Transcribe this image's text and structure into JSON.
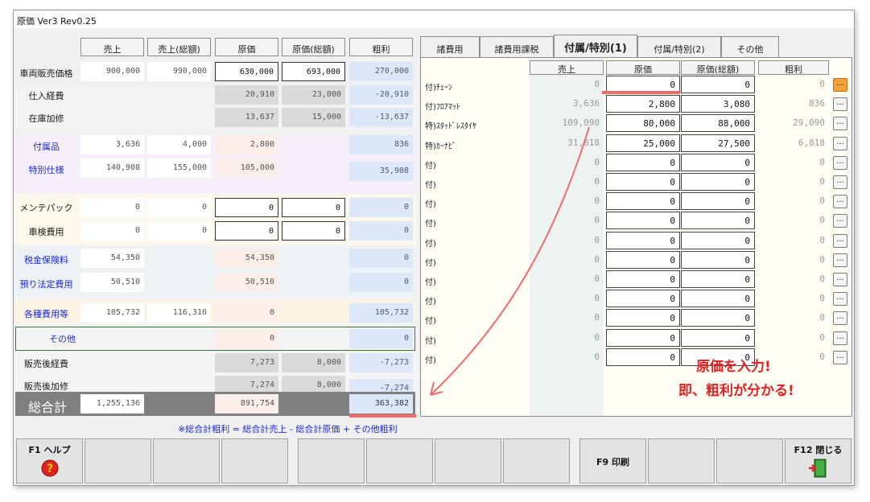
{
  "window": {
    "title": "原価 Ver3 Rev0.25"
  },
  "left": {
    "headers": [
      "売上",
      "売上(総額)",
      "原価",
      "原価(総額)",
      "粗利"
    ],
    "rows": [
      {
        "label": "車両販売価格",
        "sales": "900,000",
        "sales_total": "990,000",
        "cost": "630,000",
        "cost_total": "693,000",
        "gross": "270,000"
      },
      {
        "label": "仕入経費",
        "sales": "",
        "sales_total": "",
        "cost": "20,910",
        "cost_total": "23,000",
        "gross": "-20,910"
      },
      {
        "label": "在庫加修",
        "sales": "",
        "sales_total": "",
        "cost": "13,637",
        "cost_total": "15,000",
        "gross": "-13,637"
      },
      {
        "label": "付属品",
        "sales": "3,636",
        "sales_total": "4,000",
        "cost": "2,800",
        "cost_total": "",
        "gross": "836"
      },
      {
        "label": "特別仕様",
        "sales": "140,908",
        "sales_total": "155,000",
        "cost": "105,000",
        "cost_total": "",
        "gross": "35,908"
      },
      {
        "label": "メンテパック",
        "sales": "0",
        "sales_total": "0",
        "cost": "0",
        "cost_total": "0",
        "gross": "0"
      },
      {
        "label": "車検費用",
        "sales": "0",
        "sales_total": "0",
        "cost": "0",
        "cost_total": "0",
        "gross": "0"
      },
      {
        "label": "税金保険料",
        "sales": "54,350",
        "sales_total": "",
        "cost": "54,350",
        "cost_total": "",
        "gross": "0"
      },
      {
        "label": "預り法定費用",
        "sales": "50,510",
        "sales_total": "",
        "cost": "50,510",
        "cost_total": "",
        "gross": "0"
      },
      {
        "label": "各種費用等",
        "sales": "105,732",
        "sales_total": "116,310",
        "cost": "0",
        "cost_total": "",
        "gross": "105,732"
      },
      {
        "label": "その他",
        "sales": "",
        "sales_total": "",
        "cost": "0",
        "cost_total": "",
        "gross": "0"
      },
      {
        "label": "販売後経費",
        "sales": "",
        "sales_total": "",
        "cost": "7,273",
        "cost_total": "8,000",
        "gross": "-7,273"
      },
      {
        "label": "販売後加修",
        "sales": "",
        "sales_total": "",
        "cost": "7,274",
        "cost_total": "8,000",
        "gross": "-7,274"
      }
    ],
    "total": {
      "label": "総合計",
      "sales": "1,255,136",
      "cost": "891,754",
      "gross": "363,382"
    },
    "note": "※総合計粗利 = 総合計売上 - 総合計原価 + その他粗利"
  },
  "tabs": [
    "諸費用",
    "諸費用課税",
    "付属/特別(1)",
    "付属/特別(2)",
    "その他"
  ],
  "right": {
    "headers": [
      "売上",
      "原価",
      "原価(総額)",
      "粗利"
    ],
    "dots_label": "...",
    "rows": [
      {
        "label": "付)ﾁｪｰﾝ",
        "sales": "0",
        "cost": "0",
        "cost_total": "0",
        "gross": "0"
      },
      {
        "label": "付)ﾌﾛｱﾏｯﾄ",
        "sales": "3,636",
        "cost": "2,800",
        "cost_total": "3,080",
        "gross": "836"
      },
      {
        "label": "特)ｽﾀｯﾄﾞﾚｽﾀｲﾔ",
        "sales": "109,090",
        "cost": "80,000",
        "cost_total": "88,000",
        "gross": "29,090"
      },
      {
        "label": "特)ｶｰﾅﾋﾞ",
        "sales": "31,818",
        "cost": "25,000",
        "cost_total": "27,500",
        "gross": "6,818"
      },
      {
        "label": "付)",
        "sales": "0",
        "cost": "0",
        "cost_total": "0",
        "gross": "0"
      },
      {
        "label": "付)",
        "sales": "0",
        "cost": "0",
        "cost_total": "0",
        "gross": "0"
      },
      {
        "label": "付)",
        "sales": "0",
        "cost": "0",
        "cost_total": "0",
        "gross": "0"
      },
      {
        "label": "付)",
        "sales": "0",
        "cost": "0",
        "cost_total": "0",
        "gross": "0"
      },
      {
        "label": "付)",
        "sales": "0",
        "cost": "0",
        "cost_total": "0",
        "gross": "0"
      },
      {
        "label": "付)",
        "sales": "0",
        "cost": "0",
        "cost_total": "0",
        "gross": "0"
      },
      {
        "label": "付)",
        "sales": "0",
        "cost": "0",
        "cost_total": "0",
        "gross": "0"
      },
      {
        "label": "付)",
        "sales": "0",
        "cost": "0",
        "cost_total": "0",
        "gross": "0"
      },
      {
        "label": "付)",
        "sales": "0",
        "cost": "0",
        "cost_total": "0",
        "gross": "0"
      },
      {
        "label": "付)",
        "sales": "0",
        "cost": "0",
        "cost_total": "0",
        "gross": "0"
      },
      {
        "label": "付)",
        "sales": "0",
        "cost": "0",
        "cost_total": "0",
        "gross": "0"
      }
    ]
  },
  "annotation": {
    "line1": "原価を入力!",
    "line2": "即、粗利が分かる!"
  },
  "fkeys": [
    {
      "label": "F1 ヘルプ",
      "icon": "help-icon"
    },
    {
      "label": ""
    },
    {
      "label": ""
    },
    {
      "label": ""
    },
    {
      "label": ""
    },
    {
      "label": ""
    },
    {
      "label": ""
    },
    {
      "label": ""
    },
    {
      "label": "F9 印刷"
    },
    {
      "label": ""
    },
    {
      "label": ""
    },
    {
      "label": "F12 閉じる",
      "icon": "exit-door-icon"
    }
  ],
  "colors": {
    "accent_red": "#e02222",
    "link_blue": "#1a2bd0",
    "orange_button": "#f3a13a"
  }
}
